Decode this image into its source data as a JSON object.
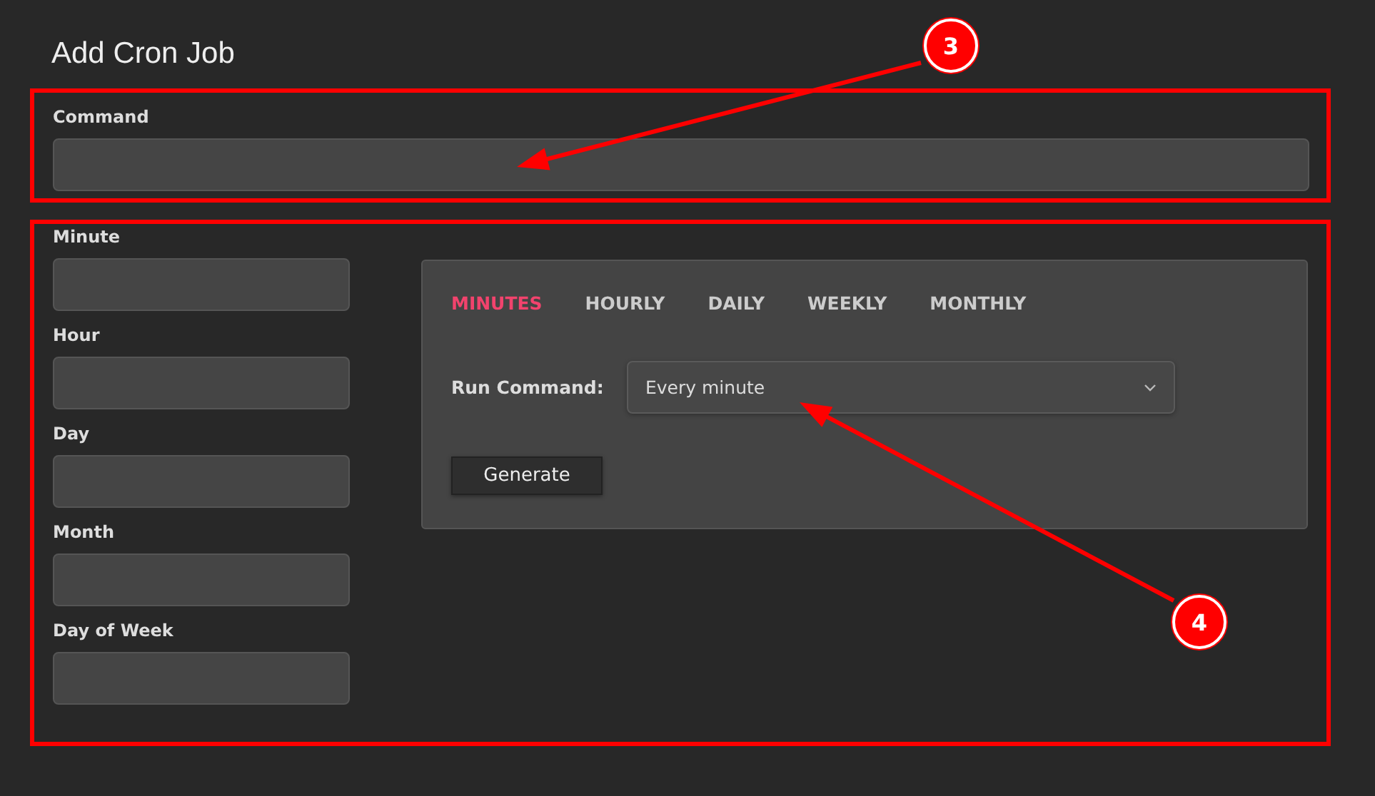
{
  "title": "Add Cron Job",
  "command": {
    "label": "Command"
  },
  "fields": [
    {
      "label": "Minute"
    },
    {
      "label": "Hour"
    },
    {
      "label": "Day"
    },
    {
      "label": "Month"
    },
    {
      "label": "Day of Week"
    }
  ],
  "tabs": [
    {
      "label": "MINUTES",
      "selected": true
    },
    {
      "label": "HOURLY",
      "selected": false
    },
    {
      "label": "DAILY",
      "selected": false
    },
    {
      "label": "WEEKLY",
      "selected": false
    },
    {
      "label": "MONTHLY",
      "selected": false
    }
  ],
  "run_command": {
    "label": "Run Command:",
    "value": "Every minute"
  },
  "generate_button": "Generate",
  "callouts": [
    {
      "number": "3"
    },
    {
      "number": "4"
    }
  ]
}
